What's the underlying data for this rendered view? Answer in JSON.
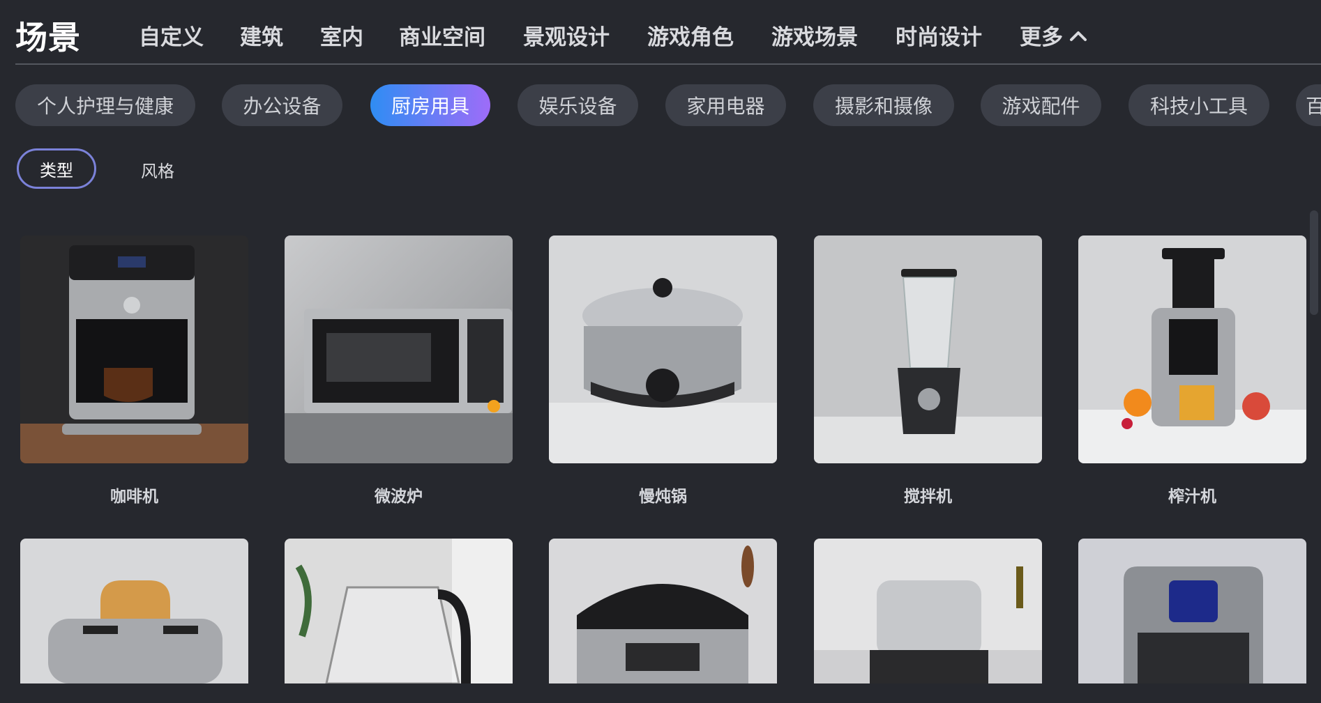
{
  "header": {
    "title": "场景",
    "tabs": [
      "自定义",
      "建筑",
      "室内",
      "商业空间",
      "景观设计",
      "游戏角色",
      "游戏场景",
      "时尚设计"
    ],
    "more_label": "更多"
  },
  "categories": {
    "items": [
      "个人护理与健康",
      "办公设备",
      "厨房用具",
      "娱乐设备",
      "家用电器",
      "摄影和摄像",
      "游戏配件",
      "科技小工具",
      "百"
    ],
    "active": "厨房用具"
  },
  "filters": {
    "type_label": "类型",
    "style_label": "风格"
  },
  "products": [
    {
      "label": "咖啡机"
    },
    {
      "label": "微波炉"
    },
    {
      "label": "慢炖锅"
    },
    {
      "label": "搅拌机"
    },
    {
      "label": "榨汁机"
    },
    {
      "label": ""
    },
    {
      "label": ""
    },
    {
      "label": ""
    },
    {
      "label": ""
    },
    {
      "label": ""
    }
  ],
  "colors": {
    "accent_start": "#2f8df3",
    "accent_end": "#9e6cf8",
    "background": "#26282e"
  }
}
